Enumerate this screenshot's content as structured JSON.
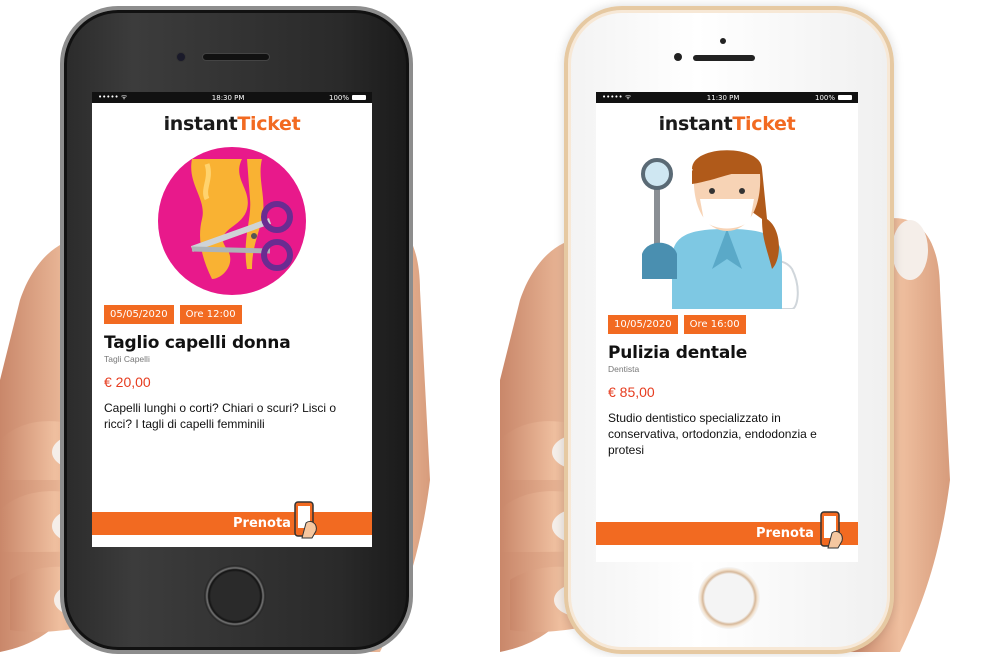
{
  "cards": [
    {
      "status": {
        "dots": "••••• ᯤ",
        "time": "18:30 PM",
        "battery": "100%"
      },
      "logo": {
        "part1": "instant",
        "part2": "Ticket"
      },
      "illustration": "scissors-hair-icon",
      "date": "05/05/2020",
      "time_label": "Ore 12:00",
      "title": "Taglio capelli donna",
      "category": "Tagli Capelli",
      "price": "€ 20,00",
      "description": "Capelli lunghi o corti? Chiari o scuri? Lisci o ricci? I tagli di capelli femminili",
      "book_label": "Prenota"
    },
    {
      "status": {
        "dots": "••••• ᯤ",
        "time": "11:30 PM",
        "battery": "100%"
      },
      "logo": {
        "part1": "instant",
        "part2": "Ticket"
      },
      "illustration": "dentist-icon",
      "date": "10/05/2020",
      "time_label": "Ore 16:00",
      "title": "Pulizia dentale",
      "category": "Dentista",
      "price": "€ 85,00",
      "description": "Studio dentistico specializzato in conservativa, ortodonzia, endodonzia e protesi",
      "book_label": "Prenota"
    }
  ],
  "colors": {
    "accent": "#f26a21",
    "price": "#e63c1f",
    "logo_dark": "#1a1a1a"
  }
}
